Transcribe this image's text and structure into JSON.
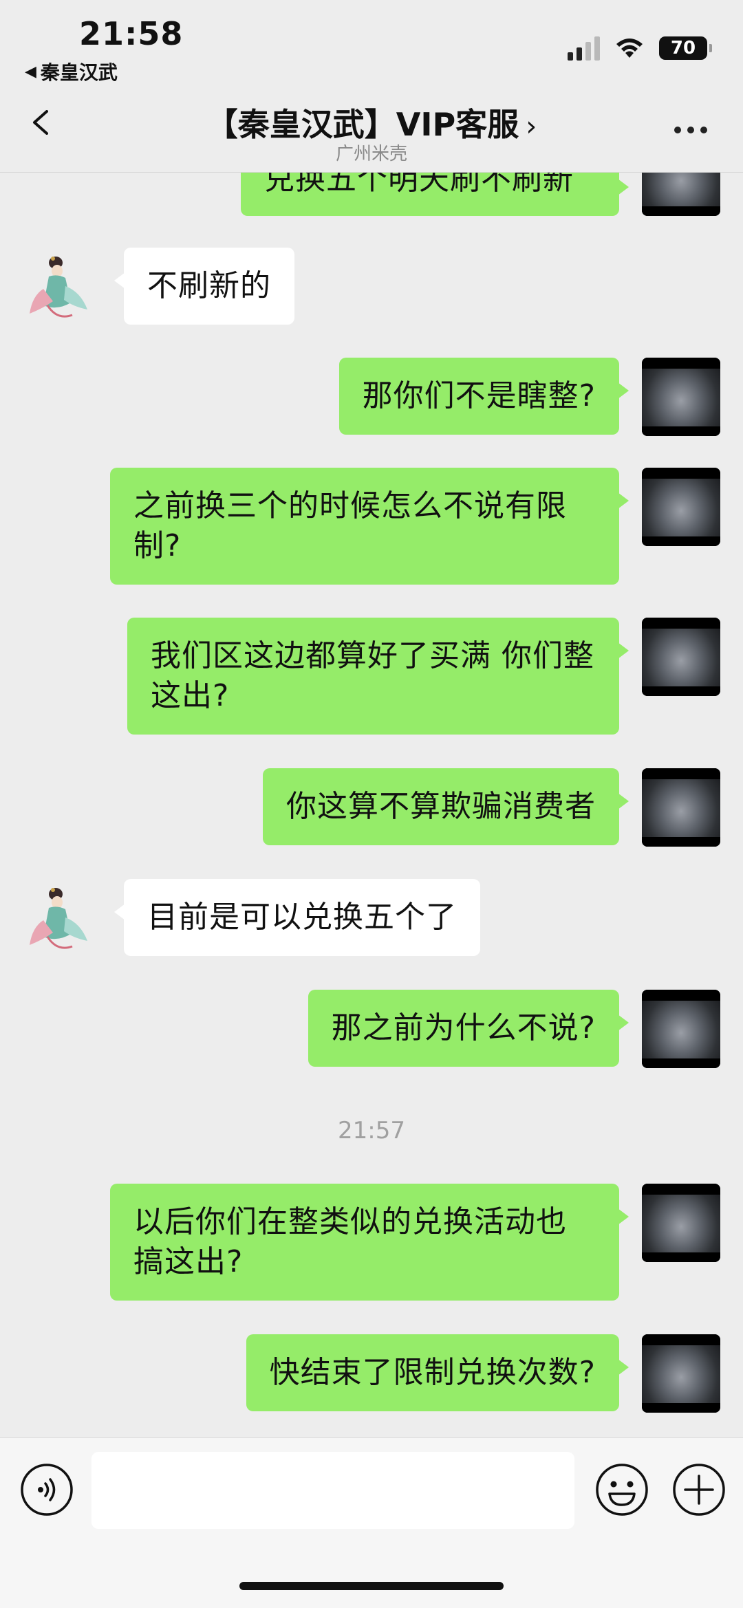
{
  "status_bar": {
    "time": "21:58",
    "back_app": "秦皇汉武",
    "battery": "70"
  },
  "nav": {
    "title": "【秦皇汉武】VIP客服",
    "subtitle": "广州米壳",
    "chevron": "›"
  },
  "messages": [
    {
      "sender": "me",
      "text": "兑换五个明天刷不刷新"
    },
    {
      "sender": "them",
      "text": "不刷新的"
    },
    {
      "sender": "me",
      "text": "那你们不是瞎整?"
    },
    {
      "sender": "me",
      "text": "之前换三个的时候怎么不说有限制?"
    },
    {
      "sender": "me",
      "text": "我们区这边都算好了买满  你们整这出?"
    },
    {
      "sender": "me",
      "text": "你这算不算欺骗消费者"
    },
    {
      "sender": "them",
      "text": "目前是可以兑换五个了"
    },
    {
      "sender": "me",
      "text": "那之前为什么不说?"
    },
    {
      "sender": "me",
      "text": "以后你们在整类似的兑换活动也搞这出?"
    },
    {
      "sender": "me",
      "text": "快结束了限制兑换次数?"
    }
  ],
  "timestamp": "21:57",
  "input": {
    "value": "",
    "placeholder": ""
  },
  "icons": {
    "voice": "voice-icon",
    "emoji": "emoji-icon",
    "plus": "plus-icon",
    "back": "chevron-left-icon",
    "more": "more-icon"
  },
  "colors": {
    "my_bubble": "#95ec69",
    "their_bubble": "#ffffff",
    "background": "#ededed"
  }
}
